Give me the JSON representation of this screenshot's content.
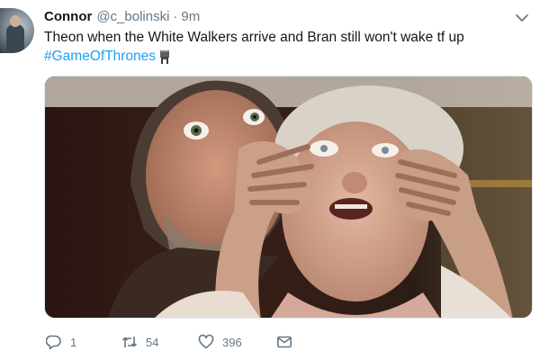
{
  "tweet": {
    "author_name": "Connor",
    "author_handle": "@c_bolinski",
    "separator": "·",
    "timestamp": "9m",
    "text": "Theon when the White Walkers arrive and Bran still won't wake tf up",
    "hashtag": "#GameOfThrones",
    "hashtag_emoji_icon": "iron-throne-icon",
    "media": {
      "type": "image",
      "icon": "photo"
    }
  },
  "actions": {
    "reply_count": "1",
    "retweet_count": "54",
    "like_count": "396",
    "reply_icon": "reply-icon",
    "retweet_icon": "retweet-icon",
    "like_icon": "heart-icon",
    "dm_icon": "envelope-icon"
  },
  "colors": {
    "text": "#14171a",
    "muted": "#657786",
    "link": "#1da1f2"
  }
}
